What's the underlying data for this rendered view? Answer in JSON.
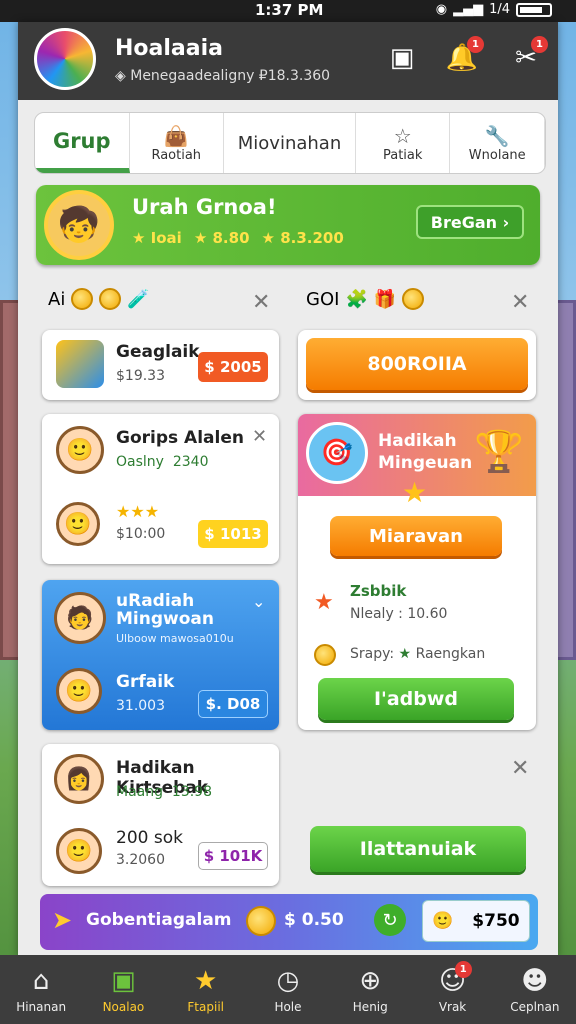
{
  "status": {
    "time": "1:37 PM",
    "signal": "▂▄▆",
    "battery_label": "1/4"
  },
  "header": {
    "title": "Hoalaaia",
    "subtitle": "Menegaadealigny ₽18.3.360",
    "icons": [
      "gift-icon",
      "bell-icon",
      "tools-icon"
    ],
    "badges": [
      "1",
      "1"
    ]
  },
  "tabs": [
    {
      "label": "Grup",
      "icon": ""
    },
    {
      "label": "Raotiah",
      "icon": "👜"
    },
    {
      "label": "Miovinahan",
      "icon": ""
    },
    {
      "label": "Patiak",
      "icon": "☆"
    },
    {
      "label": "Wnolane",
      "icon": "🔧"
    }
  ],
  "banner": {
    "title": "Urah Grnoa!",
    "stat1": "Ioai",
    "stat2": "8.80",
    "stat3": "8.3.200",
    "button": "BreGan ›"
  },
  "left_header": {
    "label": "Ai"
  },
  "right_header": {
    "label": "GOI"
  },
  "cards": {
    "c1": {
      "title": "Geaglaik",
      "sub": "$19.33",
      "price": "$ 2005"
    },
    "c2": {
      "title": "Gorips Alalen",
      "sub1": "Oaslny",
      "sub1b": "2340",
      "stars": "★★★",
      "sub2": "$10:00",
      "price": "$ 1013"
    },
    "c3": {
      "title": "uRadiah Mingwoan",
      "note": "Ulboow mawosa010u",
      "title2": "Grfaik",
      "sub": "31.003",
      "price": "$. D08"
    },
    "c4": {
      "title": "Hadikan Kirtsebak",
      "sub1": "Maang",
      "sub1b": "13.98",
      "title2": "200 sok",
      "sub2": "3.2060",
      "price": "$ 101K"
    },
    "r1": {
      "button": "800ROIIA"
    },
    "r2": {
      "title": "Hadikah Mingeuan",
      "button": "Miaravan",
      "list_title": "Zsbbik",
      "list_sub": "Nlealy : 10.60",
      "coin_text": "Srapy:",
      "coin_text2": "Raengkan",
      "button2": "I'adbwd"
    },
    "r3": {
      "button": "Ilattanuiak"
    }
  },
  "promo": {
    "label": "Gobentiagalam",
    "amount": "$ 0.50",
    "price": "$750"
  },
  "nav": [
    {
      "label": "Hinanan",
      "icon": "home-icon"
    },
    {
      "label": "Noalao",
      "icon": "gift-icon"
    },
    {
      "label": "Ftapiil",
      "icon": "trophy-icon"
    },
    {
      "label": "Hole",
      "icon": "clock-icon"
    },
    {
      "label": "Henig",
      "icon": "search-icon"
    },
    {
      "label": "Vrak",
      "icon": "person-icon"
    },
    {
      "label": "Ceplnan",
      "icon": "profile-icon"
    }
  ]
}
